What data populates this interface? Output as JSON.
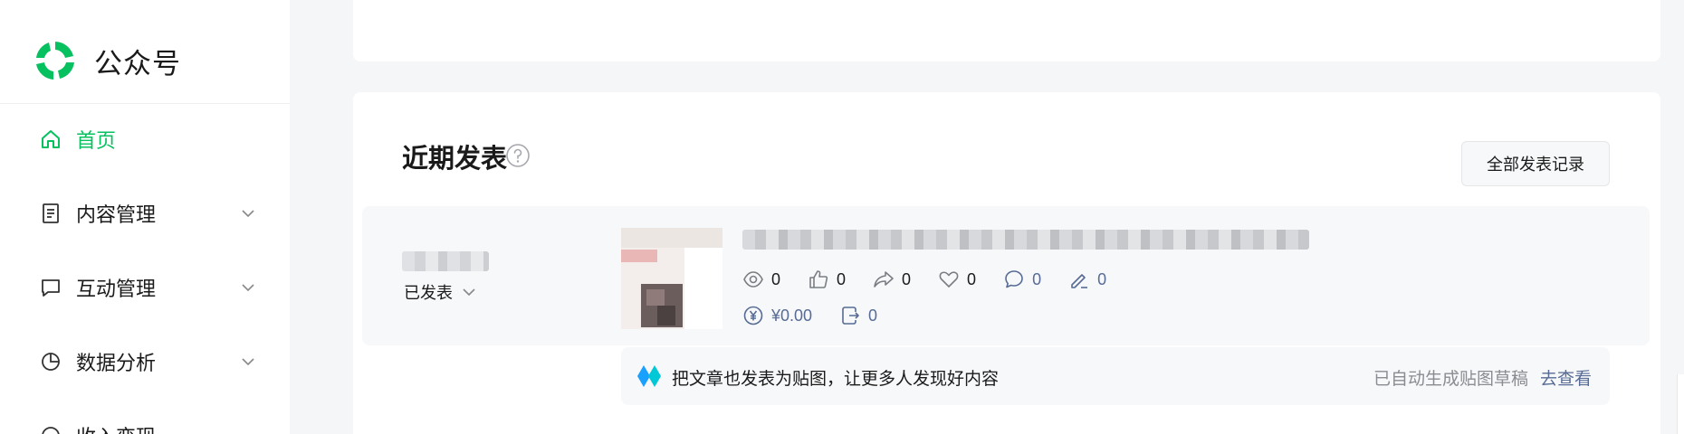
{
  "brand": {
    "name": "公众号",
    "logo_icon": "wechat-official-account-logo",
    "accent": "#07c160"
  },
  "sidebar": {
    "items": [
      {
        "label": "首页",
        "icon": "home-icon",
        "active": true,
        "expandable": false
      },
      {
        "label": "内容管理",
        "icon": "document-icon",
        "active": false,
        "expandable": true
      },
      {
        "label": "互动管理",
        "icon": "message-icon",
        "active": false,
        "expandable": true
      },
      {
        "label": "数据分析",
        "icon": "pie-chart-icon",
        "active": false,
        "expandable": true
      },
      {
        "label": "收入变现",
        "icon": "money-icon",
        "active": false,
        "expandable": true
      }
    ]
  },
  "recent": {
    "title": "近期发表",
    "help_icon": "question-circle-icon",
    "all_records_label": "全部发表记录",
    "article": {
      "status_label": "已发表",
      "stats": {
        "reads": "0",
        "likes": "0",
        "shares": "0",
        "favorites": "0",
        "comments": "0",
        "notes": "0",
        "earnings": "¥0.00",
        "reposts": "0"
      }
    },
    "promo": {
      "text": "把文章也发表为贴图，让更多人发现好内容",
      "status": "已自动生成贴图草稿",
      "link": "去查看"
    }
  },
  "colors": {
    "link": "#576b95",
    "muted": "#8a8c91"
  }
}
